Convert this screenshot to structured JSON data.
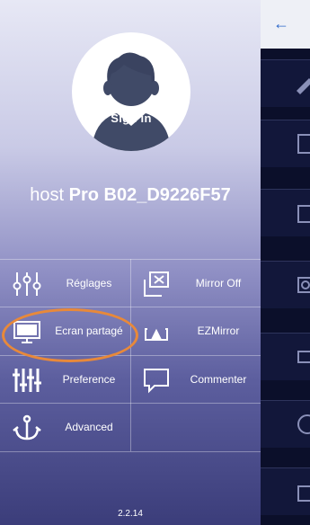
{
  "profile": {
    "signin_label": "Sign in"
  },
  "host": {
    "prefix": "host",
    "name": "Pro B02_D9226F57"
  },
  "menu": {
    "settings": "Réglages",
    "mirror_off": "Mirror Off",
    "split_screen": "Ecran partagé",
    "ezmirror": "EZMirror",
    "preference": "Preference",
    "comment": "Commenter",
    "advanced": "Advanced"
  },
  "version": "2.2.14",
  "colors": {
    "highlight": "#e8893a",
    "back_arrow": "#2c67c9"
  }
}
